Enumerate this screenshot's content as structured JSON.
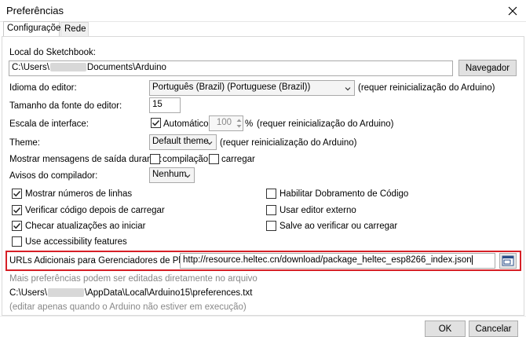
{
  "window": {
    "title": "Preferências",
    "close_glyph": "✕"
  },
  "tabs": [
    {
      "label": "Configurações",
      "active": true
    },
    {
      "label": "Rede",
      "active": false
    }
  ],
  "sketchbook": {
    "label": "Local do Sketchbook:",
    "path_prefix": "C:\\Users\\",
    "path_suffix": "Documents\\Arduino",
    "browse_button": "Navegador"
  },
  "editor_language": {
    "label": "Idioma do editor:",
    "value": "Português (Brazil) (Portuguese (Brazil))",
    "note": "(requer reinicialização do Arduino)"
  },
  "font_size": {
    "label": "Tamanho da fonte do editor:",
    "value": "15"
  },
  "interface_scale": {
    "label": "Escala de interface:",
    "auto_label": "Automático",
    "auto_checked": true,
    "value": "100",
    "unit": "%",
    "note": "(requer reinicialização do Arduino)"
  },
  "theme": {
    "label": "Theme:",
    "value": "Default theme",
    "note": "(requer reinicialização do Arduino)"
  },
  "verbose_output": {
    "label": "Mostrar mensagens de saída durante:",
    "compile_label": "compilação",
    "compile_checked": false,
    "upload_label": "carregar",
    "upload_checked": false
  },
  "compiler_warnings": {
    "label": "Avisos do compilador:",
    "value": "Nenhum"
  },
  "options_left": [
    {
      "label": "Mostrar números de linhas",
      "checked": true
    },
    {
      "label": "Verificar código depois de carregar",
      "checked": true
    },
    {
      "label": "Checar atualizações ao iniciar",
      "checked": true
    },
    {
      "label": "Use accessibility features",
      "checked": false
    }
  ],
  "options_right": [
    {
      "label": "Habilitar Dobramento de Código",
      "checked": false
    },
    {
      "label": "Usar editor externo",
      "checked": false
    },
    {
      "label": "Salve ao verificar ou carregar",
      "checked": false
    }
  ],
  "board_urls": {
    "label": "URLs Adicionais para Gerenciadores de Placas:",
    "value": "http://resource.heltec.cn/download/package_heltec_esp8266_index.json"
  },
  "more_prefs": {
    "note": "Mais preferências podem ser editadas diretamente no arquivo",
    "path_prefix": "C:\\Users\\",
    "path_suffix": "\\AppData\\Local\\Arduino15\\preferences.txt",
    "edit_note": "(editar apenas quando o Arduino não estiver em execução)"
  },
  "footer": {
    "ok_button": "OK",
    "cancel_button": "Cancelar"
  },
  "colors": {
    "highlight_border": "#d61f26",
    "button_face": "#e1e1e1",
    "muted_text": "#888888"
  }
}
